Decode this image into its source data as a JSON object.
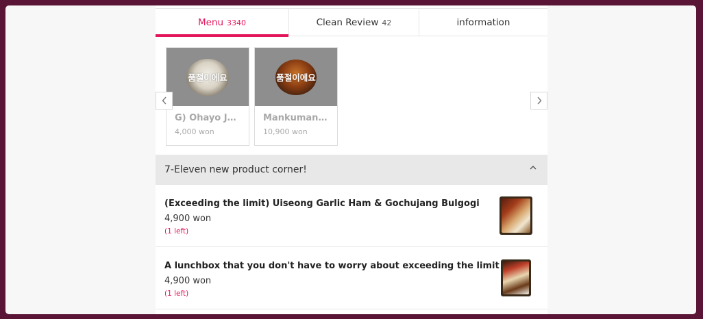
{
  "tabs": [
    {
      "label": "Menu",
      "count": "3340",
      "active": true
    },
    {
      "label": "Clean Review",
      "count": "42",
      "active": false
    },
    {
      "label": "information",
      "count": "",
      "active": false
    }
  ],
  "carousel": {
    "items": [
      {
        "name": "G) Ohayo Jers...",
        "price": "4,000 won",
        "badge": "품절이에요"
      },
      {
        "name": "Mankumangu ...",
        "price": "10,900 won",
        "badge": "품절이에요"
      }
    ],
    "prev_icon": "chevron-left-icon",
    "next_icon": "chevron-right-icon"
  },
  "section": {
    "title": "7-Eleven new product corner!",
    "collapse_icon": "chevron-up-icon",
    "items": [
      {
        "name": "(Exceeding the limit) Uiseong Garlic Ham & Gochujang Bulgogi",
        "price": "4,900 won",
        "stock": "(1 left)"
      },
      {
        "name": "A lunchbox that you don't have to worry about exceeding the limit",
        "price": "4,900 won",
        "stock": "(1 left)"
      }
    ]
  },
  "colors": {
    "accent": "#e3165b",
    "background": "#5a1536"
  }
}
